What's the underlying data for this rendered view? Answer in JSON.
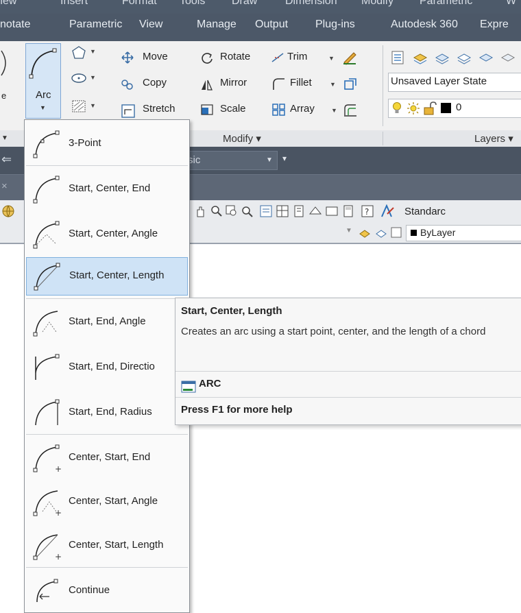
{
  "menubar": {
    "items": [
      "View",
      "Insert",
      "Format",
      "Tools",
      "Draw",
      "Dimension",
      "Modify",
      "Parametric",
      "W"
    ]
  },
  "tabs": [
    "notate",
    "Parametric",
    "View",
    "Manage",
    "Output",
    "Plug-ins",
    "Autodesk 360",
    "Expre"
  ],
  "ribbon": {
    "arc_label": "Arc",
    "left_cut_letter": "e",
    "modify": {
      "move": "Move",
      "rotate": "Rotate",
      "trim": "Trim",
      "copy": "Copy",
      "mirror": "Mirror",
      "fillet": "Fillet",
      "stretch": "Stretch",
      "scale": "Scale",
      "array": "Array"
    },
    "layers": {
      "state": "Unsaved Layer State",
      "current_layer": "0"
    },
    "panel_modify": "Modify",
    "panel_layers": "Layers"
  },
  "toolbar": {
    "workspace_cut": "sic",
    "text_style": "Standarc",
    "color_value": "ByLayer"
  },
  "arc_menu": {
    "items": [
      "3-Point",
      "Start, Center, End",
      "Start, Center, Angle",
      "Start, Center, Length",
      "Start, End, Angle",
      "Start, End, Directio",
      "Start, End, Radius",
      "Center, Start, End",
      "Center, Start, Angle",
      "Center, Start, Length",
      "Continue"
    ],
    "selected_index": 3
  },
  "tooltip": {
    "title": "Start, Center, Length",
    "description": "Creates an arc using a start point, center, and the length of a chord",
    "command": "ARC",
    "help": "Press F1 for more help"
  }
}
